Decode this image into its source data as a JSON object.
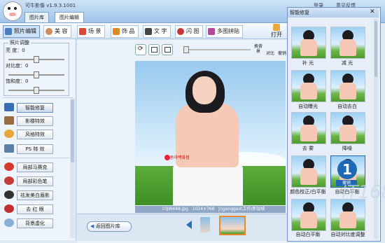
{
  "app": {
    "title": "可牛影像",
    "version": "v1.9.3.1001"
  },
  "tabs": [
    {
      "label": "图片库",
      "active": false
    },
    {
      "label": "图片编辑",
      "active": true
    }
  ],
  "topright": {
    "item1": "登录",
    "item2": "意见反馈"
  },
  "toolbar": {
    "buttons": [
      {
        "label": "照片编辑",
        "icon": "photo-edit-icon",
        "active": true
      },
      {
        "label": "美 容",
        "icon": "beauty-icon",
        "active": false
      },
      {
        "label": "场 景",
        "icon": "scene-icon",
        "active": false
      },
      {
        "label": "饰 品",
        "icon": "accessory-icon",
        "active": false
      },
      {
        "label": "文 字",
        "icon": "text-icon",
        "active": false
      },
      {
        "label": "闪 图",
        "icon": "flash-icon",
        "active": false
      },
      {
        "label": "多图拼贴",
        "icon": "collage-icon",
        "active": false
      }
    ],
    "open_label": "打开"
  },
  "adjust": {
    "legend": "照片调整",
    "sliders": [
      {
        "label": "亮  度：",
        "value": "0"
      },
      {
        "label": "对比度：",
        "value": "0"
      },
      {
        "label": "饱和度：",
        "value": "0"
      }
    ]
  },
  "side_buttons": [
    {
      "label": "智能修复",
      "icon": "smart-fix-icon",
      "color": "#3a6fb3",
      "active": true
    },
    {
      "label": "影楼特效",
      "icon": "studio-effect-icon",
      "color": "#9a6c43",
      "active": false
    },
    {
      "label": "风格特效",
      "icon": "style-effect-icon",
      "color": "#e8a53a",
      "active": false
    },
    {
      "label": "PS 特 效",
      "icon": "ps-effect-icon",
      "color": "#5b7fa6",
      "active": false
    },
    {
      "label": "局部马赛克",
      "icon": "mosaic-icon",
      "color": "#d23b2e",
      "active": false
    },
    {
      "label": "局部彩色笔",
      "icon": "color-pen-icon",
      "color": "#c43b3b",
      "active": false
    },
    {
      "label": "祛发美白眉影",
      "icon": "whiten-icon",
      "color": "#333333",
      "active": false
    },
    {
      "label": "去 红 眼",
      "icon": "red-eye-icon",
      "color": "#c03030",
      "active": false
    },
    {
      "label": "背景虚化",
      "icon": "blur-bg-icon",
      "color": "#8bb0d6",
      "active": false
    }
  ],
  "view": {
    "fit_label": "换背景",
    "compare_label": "对比",
    "undo_label": "撤销"
  },
  "image_info": {
    "filename": "10JW448.jpg",
    "size": "1024×768",
    "path": "J:\\genggao\\工作\\新加坡"
  },
  "photo_brand": "동아백화점",
  "bottom": {
    "back_label": "返回图片库"
  },
  "right_panel": {
    "title": "智能修复",
    "items": [
      {
        "label": "补  光"
      },
      {
        "label": "减  光"
      },
      {
        "label": "自动曝光"
      },
      {
        "label": "自动去白"
      },
      {
        "label": "去  雾"
      },
      {
        "label": "降噪"
      },
      {
        "label": "颜色校正/白平衡"
      },
      {
        "label": "自动白平衡"
      },
      {
        "label": "自动白平衡"
      },
      {
        "label": "自动对比度调整"
      }
    ],
    "badge_number": "1",
    "badge_label": "撤销"
  },
  "watermark": "IT168"
}
